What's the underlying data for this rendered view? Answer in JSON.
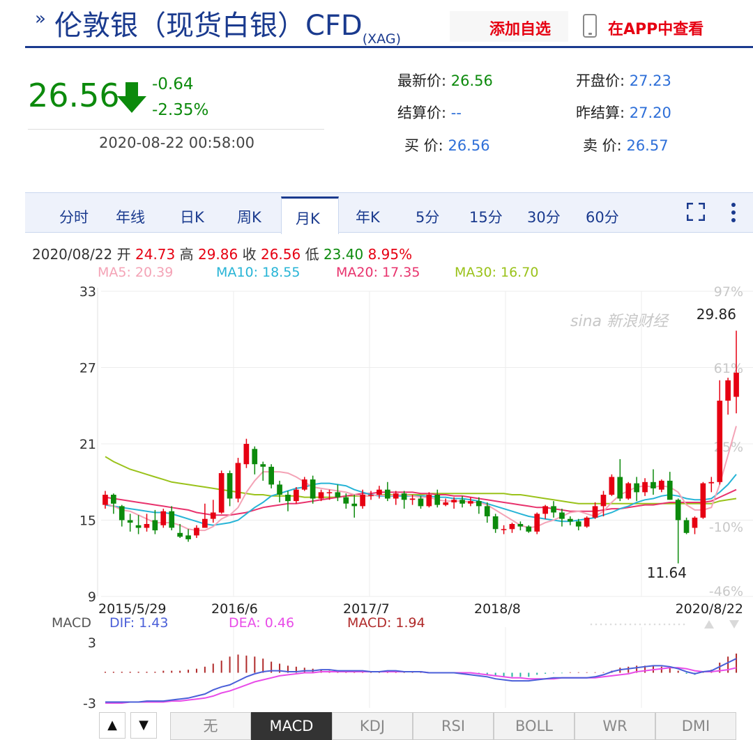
{
  "header": {
    "title": "伦敦银（现货白银）CFD",
    "code": "(XAG)",
    "add_label": "添加自选",
    "app_label": "在APP中查看"
  },
  "quote": {
    "price": "26.56",
    "change": "-0.64",
    "change_pct": "-2.35%",
    "datetime": "2020-08-22 00:58:00",
    "fields": [
      {
        "label": "最新价:",
        "value": "26.56",
        "tone": "g"
      },
      {
        "label": "开盘价:",
        "value": "27.23",
        "tone": "b"
      },
      {
        "label": "结算价:",
        "value": "--",
        "tone": "b"
      },
      {
        "label": "昨结算:",
        "value": "27.20",
        "tone": "b"
      },
      {
        "label": "买  价:",
        "value": "26.56",
        "tone": "b"
      },
      {
        "label": "卖  价:",
        "value": "26.57",
        "tone": "b"
      }
    ]
  },
  "tabs": [
    "分时",
    "年线",
    "日K",
    "周K",
    "月K",
    "年K",
    "5分",
    "15分",
    "30分",
    "60分"
  ],
  "active_tab": "月K",
  "info": {
    "date": "2020/08/22",
    "open_label": "开",
    "open": "24.73",
    "high_label": "高",
    "high": "29.86",
    "close_label": "收",
    "close": "26.56",
    "low_label": "低",
    "low": "23.40",
    "pct": "8.95%"
  },
  "ma": {
    "ma5": "MA5: 20.39",
    "ma10": "MA10: 18.55",
    "ma20": "MA20: 17.35",
    "ma30": "MA30: 16.70"
  },
  "macd_info": {
    "label": "MACD",
    "dif": "DIF: 1.43",
    "dea": "DEA: 0.46",
    "macd": "MACD: 1.94"
  },
  "watermark": "sina 新浪财经",
  "indicator_buttons": [
    "无",
    "MACD",
    "KDJ",
    "RSI",
    "BOLL",
    "WR",
    "DMI"
  ],
  "active_indicator": "MACD",
  "colors": {
    "up": "#e60012",
    "down": "#0c8a0c",
    "ma5": "#f4a3b6",
    "ma10": "#27b4d6",
    "ma20": "#e8336d",
    "ma30": "#9ac21a",
    "dif": "#4a5fd8",
    "dea": "#e84ce8",
    "brand": "#1a3a8e"
  },
  "chart_data": {
    "type": "candlestick",
    "period": "monthly",
    "y_axis_labels": [
      "33",
      "27",
      "21",
      "15",
      "9"
    ],
    "ylim": [
      9,
      33
    ],
    "pct_labels": [
      "97%",
      "61%",
      "25%",
      "-10%",
      "-46%"
    ],
    "x_labels": [
      "2015/5/29",
      "2016/6",
      "2017/7",
      "2018/8",
      "2020/8/22"
    ],
    "annotations": {
      "max": "29.86",
      "min": "11.64"
    },
    "candles": [
      [
        16.2,
        17.0,
        17.3,
        15.9
      ],
      [
        17.0,
        16.3,
        17.1,
        15.5
      ],
      [
        16.1,
        15.0,
        16.2,
        14.5
      ],
      [
        15.0,
        14.8,
        15.5,
        14.1
      ],
      [
        14.6,
        14.4,
        15.4,
        13.9
      ],
      [
        14.4,
        14.7,
        15.5,
        14.1
      ],
      [
        15.0,
        14.2,
        15.8,
        13.9
      ],
      [
        14.6,
        15.7,
        15.9,
        14.4
      ],
      [
        15.7,
        14.4,
        16.1,
        14.2
      ],
      [
        14.0,
        13.7,
        14.7,
        13.6
      ],
      [
        13.8,
        13.5,
        14.3,
        13.3
      ],
      [
        13.8,
        14.4,
        14.6,
        13.6
      ],
      [
        14.4,
        15.1,
        16.3,
        14.4
      ],
      [
        15.1,
        15.6,
        16.6,
        14.8
      ],
      [
        15.6,
        18.7,
        18.9,
        15.5
      ],
      [
        18.7,
        16.7,
        18.9,
        16.1
      ],
      [
        16.7,
        19.5,
        19.9,
        16.4
      ],
      [
        19.4,
        21.0,
        21.4,
        19.1
      ],
      [
        20.6,
        19.4,
        20.8,
        18.6
      ],
      [
        19.4,
        19.2,
        19.6,
        18.1
      ],
      [
        19.2,
        17.8,
        19.4,
        17.5
      ],
      [
        17.8,
        17.0,
        18.1,
        16.4
      ],
      [
        17.0,
        16.5,
        17.3,
        15.7
      ],
      [
        16.5,
        17.4,
        17.6,
        16.3
      ],
      [
        17.4,
        18.2,
        18.4,
        17.3
      ],
      [
        18.2,
        16.7,
        18.5,
        16.3
      ],
      [
        16.7,
        17.2,
        17.4,
        16.5
      ],
      [
        17.2,
        17.2,
        17.4,
        16.6
      ],
      [
        17.2,
        16.8,
        17.8,
        16.5
      ],
      [
        16.8,
        16.3,
        17.1,
        15.9
      ],
      [
        16.3,
        16.1,
        17.0,
        15.2
      ],
      [
        16.1,
        17.0,
        17.4,
        15.9
      ],
      [
        17.0,
        17.0,
        17.3,
        16.6
      ],
      [
        17.0,
        17.4,
        17.7,
        16.7
      ],
      [
        17.4,
        16.7,
        18.0,
        16.5
      ],
      [
        16.7,
        17.1,
        17.3,
        16.2
      ],
      [
        17.1,
        16.6,
        17.3,
        15.9
      ],
      [
        16.6,
        16.7,
        17.0,
        16.2
      ],
      [
        16.7,
        16.1,
        16.9,
        15.9
      ],
      [
        16.1,
        17.0,
        17.2,
        16.0
      ],
      [
        17.0,
        16.2,
        17.4,
        16.0
      ],
      [
        16.2,
        16.4,
        16.7,
        16.1
      ],
      [
        16.4,
        16.6,
        16.8,
        15.9
      ],
      [
        16.6,
        16.3,
        16.9,
        16.0
      ],
      [
        16.3,
        16.5,
        16.8,
        16.1
      ],
      [
        16.5,
        16.1,
        16.8,
        15.5
      ],
      [
        16.1,
        15.3,
        16.4,
        14.8
      ],
      [
        15.3,
        14.3,
        15.5,
        14.0
      ],
      [
        14.3,
        14.3,
        14.6,
        13.9
      ],
      [
        14.3,
        14.7,
        14.8,
        14.0
      ],
      [
        14.7,
        14.5,
        14.9,
        14.2
      ],
      [
        14.5,
        14.1,
        14.6,
        14.0
      ],
      [
        14.1,
        15.5,
        15.6,
        13.9
      ],
      [
        15.5,
        16.1,
        16.2,
        15.1
      ],
      [
        16.1,
        15.6,
        16.5,
        15.2
      ],
      [
        15.6,
        15.1,
        15.9,
        14.5
      ],
      [
        15.1,
        14.9,
        15.3,
        14.6
      ],
      [
        14.9,
        14.5,
        15.1,
        14.2
      ],
      [
        14.5,
        15.2,
        15.3,
        14.4
      ],
      [
        15.2,
        16.1,
        16.4,
        15.1
      ],
      [
        16.1,
        17.0,
        17.3,
        15.3
      ],
      [
        17.0,
        18.4,
        18.6,
        16.9
      ],
      [
        18.4,
        16.7,
        19.8,
        16.5
      ],
      [
        16.7,
        17.9,
        18.0,
        16.6
      ],
      [
        17.9,
        17.2,
        18.4,
        16.5
      ],
      [
        17.2,
        18.0,
        18.3,
        16.9
      ],
      [
        18.0,
        17.5,
        19.0,
        17.0
      ],
      [
        17.4,
        18.1,
        18.2,
        17.2
      ],
      [
        18.1,
        16.6,
        18.8,
        16.6
      ],
      [
        16.6,
        15.0,
        16.7,
        11.6
      ],
      [
        15.0,
        14.0,
        15.2,
        13.9
      ],
      [
        14.4,
        15.2,
        15.3,
        13.9
      ],
      [
        15.2,
        17.9,
        18.0,
        15.1
      ],
      [
        17.9,
        18.0,
        18.4,
        17.2
      ],
      [
        18.0,
        24.4,
        26.0,
        17.8
      ],
      [
        24.4,
        26.0,
        26.2,
        23.3
      ],
      [
        24.7,
        26.6,
        29.9,
        23.4
      ]
    ],
    "ma5": [
      16.3,
      16.1,
      15.8,
      15.7,
      15.4,
      15.1,
      14.8,
      14.8,
      14.8,
      14.6,
      14.3,
      14.2,
      14.2,
      14.5,
      15.1,
      15.4,
      16.0,
      17.2,
      18.1,
      18.8,
      18.8,
      18.8,
      18.7,
      18.4,
      18.0,
      17.6,
      17.5,
      17.4,
      17.3,
      17.2,
      17.0,
      16.9,
      16.9,
      17.0,
      16.9,
      17.0,
      17.0,
      16.9,
      16.8,
      16.8,
      16.6,
      16.5,
      16.5,
      16.5,
      16.4,
      16.4,
      16.2,
      15.8,
      15.4,
      15.0,
      14.6,
      14.4,
      14.5,
      14.8,
      15.0,
      15.3,
      15.6,
      15.7,
      15.5,
      15.3,
      15.7,
      16.4,
      17.0,
      17.3,
      17.6,
      17.7,
      17.6,
      17.7,
      17.6,
      17.2,
      16.2,
      15.8,
      15.8,
      16.0,
      17.8,
      20.1,
      22.4
    ],
    "ma10": [
      16.2,
      16.1,
      16.0,
      15.9,
      15.8,
      15.7,
      15.6,
      15.6,
      15.5,
      15.3,
      15.1,
      14.9,
      14.7,
      14.6,
      14.7,
      14.8,
      15.0,
      15.5,
      16.0,
      16.4,
      16.9,
      17.1,
      17.3,
      17.5,
      17.6,
      17.8,
      17.9,
      17.9,
      17.8,
      17.7,
      17.4,
      17.2,
      17.0,
      16.9,
      16.9,
      16.9,
      16.9,
      16.9,
      16.9,
      16.9,
      16.8,
      16.8,
      16.7,
      16.7,
      16.6,
      16.5,
      16.3,
      16.1,
      15.9,
      15.7,
      15.5,
      15.3,
      15.2,
      15.1,
      15.0,
      14.9,
      14.9,
      15.0,
      15.1,
      15.2,
      15.4,
      15.6,
      15.9,
      16.1,
      16.4,
      16.6,
      16.7,
      16.9,
      17.0,
      16.9,
      16.7,
      16.6,
      16.6,
      16.7,
      17.2,
      17.8,
      18.6
    ],
    "ma20": [
      16.8,
      16.7,
      16.6,
      16.5,
      16.4,
      16.3,
      16.2,
      16.1,
      16.0,
      15.9,
      15.8,
      15.6,
      15.5,
      15.4,
      15.4,
      15.4,
      15.5,
      15.6,
      15.8,
      16.0,
      16.1,
      16.2,
      16.3,
      16.3,
      16.4,
      16.5,
      16.6,
      16.7,
      16.8,
      16.9,
      17.0,
      17.1,
      17.1,
      17.2,
      17.2,
      17.2,
      17.2,
      17.2,
      17.1,
      17.1,
      17.0,
      17.0,
      16.9,
      16.9,
      16.8,
      16.7,
      16.6,
      16.5,
      16.4,
      16.3,
      16.2,
      16.1,
      16.0,
      16.0,
      15.9,
      15.8,
      15.7,
      15.7,
      15.7,
      15.7,
      15.8,
      15.9,
      15.9,
      16.0,
      16.1,
      16.2,
      16.2,
      16.3,
      16.4,
      16.4,
      16.4,
      16.4,
      16.4,
      16.5,
      16.8,
      17.1,
      17.4
    ],
    "ma30": [
      20.0,
      19.6,
      19.3,
      19.0,
      18.8,
      18.6,
      18.4,
      18.2,
      18.0,
      17.9,
      17.8,
      17.7,
      17.6,
      17.5,
      17.4,
      17.3,
      17.2,
      17.1,
      17.0,
      17.0,
      16.9,
      16.9,
      16.9,
      16.9,
      16.8,
      16.8,
      16.8,
      16.8,
      16.8,
      16.9,
      16.9,
      16.9,
      16.9,
      17.0,
      17.0,
      17.0,
      17.0,
      17.0,
      17.0,
      17.1,
      17.1,
      17.1,
      17.1,
      17.1,
      17.1,
      17.1,
      17.1,
      17.1,
      17.1,
      17.0,
      17.0,
      16.9,
      16.8,
      16.7,
      16.6,
      16.5,
      16.4,
      16.3,
      16.3,
      16.3,
      16.3,
      16.3,
      16.3,
      16.3,
      16.3,
      16.3,
      16.3,
      16.3,
      16.3,
      16.3,
      16.3,
      16.3,
      16.3,
      16.3,
      16.5,
      16.6,
      16.7
    ],
    "macd_ylabels": [
      "3",
      "-3"
    ],
    "macd_ylim": [
      -3,
      3
    ],
    "macd_hist": [
      0.1,
      0.1,
      0.1,
      0.1,
      0.1,
      0.1,
      0.1,
      0.2,
      0.2,
      0.2,
      0.3,
      0.4,
      0.6,
      0.9,
      1.2,
      1.6,
      1.8,
      1.7,
      1.6,
      1.4,
      1.1,
      0.9,
      0.7,
      0.6,
      0.5,
      0.4,
      0.3,
      0.2,
      0.1,
      0.1,
      0.1,
      0.1,
      0.05,
      0.05,
      0.05,
      0.05,
      0.05,
      0.05,
      0.05,
      0.05,
      0.05,
      0.05,
      0.05,
      0.05,
      -0.05,
      -0.1,
      -0.2,
      -0.3,
      -0.4,
      -0.4,
      -0.4,
      -0.4,
      -0.2,
      -0.1,
      -0.05,
      -0.05,
      0.05,
      0.05,
      0.05,
      0.05,
      0.05,
      0.2,
      0.5,
      0.6,
      0.7,
      0.7,
      0.7,
      0.6,
      0.5,
      0.2,
      -0.1,
      -0.2,
      0.1,
      0.3,
      1.0,
      1.6,
      1.9
    ],
    "dif": [
      -2.9,
      -2.9,
      -2.9,
      -2.9,
      -2.9,
      -2.8,
      -2.8,
      -2.8,
      -2.7,
      -2.6,
      -2.5,
      -2.3,
      -2.1,
      -1.7,
      -1.4,
      -1.2,
      -0.8,
      -0.4,
      -0.1,
      0.1,
      0.2,
      0.2,
      0.1,
      0.1,
      0.2,
      0.2,
      0.3,
      0.3,
      0.2,
      0.2,
      0.2,
      0.2,
      0.1,
      0.1,
      0.2,
      0.2,
      0.1,
      0.1,
      0.1,
      0.0,
      0.0,
      0.0,
      0.0,
      -0.1,
      -0.2,
      -0.3,
      -0.4,
      -0.6,
      -0.7,
      -0.8,
      -0.8,
      -0.8,
      -0.7,
      -0.6,
      -0.5,
      -0.5,
      -0.5,
      -0.5,
      -0.5,
      -0.4,
      -0.2,
      0.1,
      0.3,
      0.4,
      0.5,
      0.6,
      0.7,
      0.7,
      0.6,
      0.4,
      0.1,
      -0.1,
      0.1,
      0.2,
      0.6,
      1.0,
      1.4
    ],
    "dea": [
      -3.0,
      -3.0,
      -3.0,
      -2.9,
      -2.9,
      -2.9,
      -2.9,
      -2.9,
      -2.8,
      -2.8,
      -2.7,
      -2.6,
      -2.5,
      -2.3,
      -2.0,
      -1.8,
      -1.5,
      -1.2,
      -0.9,
      -0.7,
      -0.5,
      -0.3,
      -0.2,
      -0.1,
      0.0,
      0.0,
      0.1,
      0.1,
      0.1,
      0.1,
      0.1,
      0.1,
      0.1,
      0.1,
      0.1,
      0.1,
      0.1,
      0.1,
      0.1,
      0.0,
      0.0,
      0.0,
      0.0,
      0.0,
      0.0,
      -0.1,
      -0.2,
      -0.3,
      -0.4,
      -0.5,
      -0.5,
      -0.6,
      -0.6,
      -0.6,
      -0.6,
      -0.5,
      -0.5,
      -0.5,
      -0.5,
      -0.5,
      -0.4,
      -0.3,
      -0.2,
      -0.1,
      0.1,
      0.2,
      0.3,
      0.4,
      0.5,
      0.5,
      0.4,
      0.2,
      0.1,
      0.1,
      0.2,
      0.3,
      0.5
    ]
  }
}
